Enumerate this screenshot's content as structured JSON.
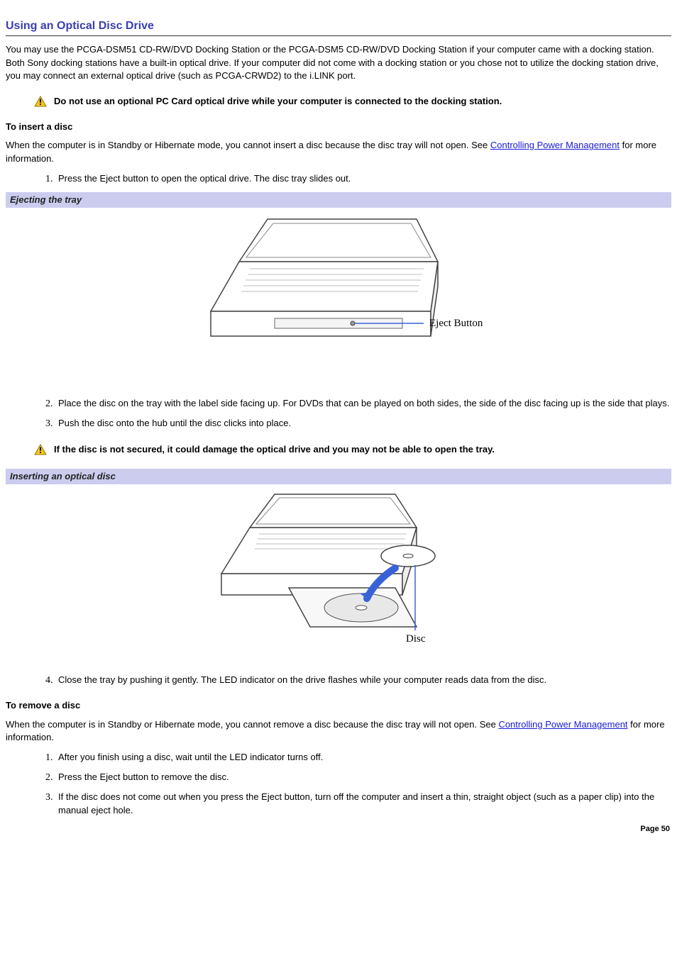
{
  "title": "Using an Optical Disc Drive",
  "intro": "You may use the PCGA-DSM51 CD-RW/DVD Docking Station or the PCGA-DSM5 CD-RW/DVD Docking Station if your computer came with a docking station. Both Sony docking stations have a built-in optical drive. If your computer did not come with a docking station or you chose not to utilize the docking station drive, you may connect an external optical drive (such as PCGA-CRWD2) to the i.LINK port.",
  "warn1": "Do not use an optional PC Card optical drive while your computer is connected to the docking station.",
  "insert": {
    "heading": "To insert a disc",
    "para_pre": "When the computer is in Standby or Hibernate mode, you cannot insert a disc because the disc tray will not open. See ",
    "link": "Controlling Power Management",
    "para_post": " for more information.",
    "step1": "Press the Eject button to open the optical drive. The disc tray slides out.",
    "step2": "Place the disc on the tray with the label side facing up. For DVDs that can be played on both sides, the side of the disc facing up is the side that plays.",
    "step3": "Push the disc onto the hub until the disc clicks into place.",
    "step4": "Close the tray by pushing it gently. The LED indicator on the drive flashes while your computer reads data from the disc."
  },
  "fig1": {
    "caption": "Ejecting the tray",
    "label": "Eject Button"
  },
  "warn2": "If the disc is not secured, it could damage the optical drive and you may not be able to open the tray.",
  "fig2": {
    "caption": "Inserting an optical disc",
    "label": "Disc"
  },
  "remove": {
    "heading": "To remove a disc",
    "para_pre": "When the computer is in Standby or Hibernate mode, you cannot remove a disc because the disc tray will not open. See ",
    "link": "Controlling Power Management",
    "para_post": " for more information.",
    "step1": "After you finish using a disc, wait until the LED indicator turns off.",
    "step2": "Press the Eject button to remove the disc.",
    "step3": "If the disc does not come out when you press the Eject button, turn off the computer and insert a thin, straight object (such as a paper clip) into the manual eject hole."
  },
  "page": "Page 50"
}
